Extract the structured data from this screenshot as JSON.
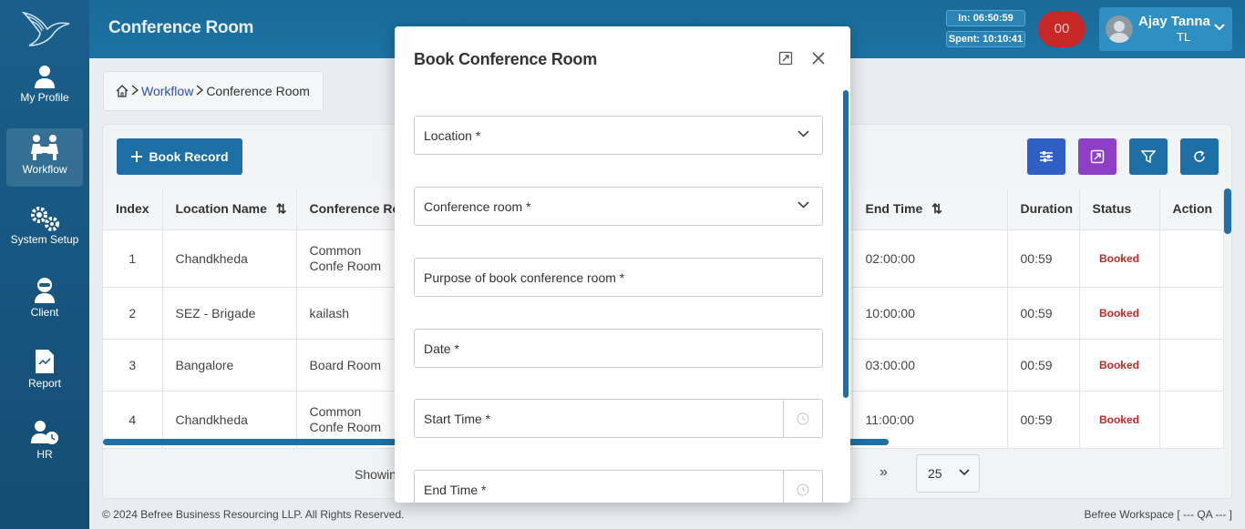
{
  "sidebar": {
    "items": [
      {
        "label": "My Profile",
        "icon": "user-icon"
      },
      {
        "label": "Workflow",
        "icon": "workflow-icon"
      },
      {
        "label": "System Setup",
        "icon": "gears-icon"
      },
      {
        "label": "Client",
        "icon": "client-icon"
      },
      {
        "label": "Report",
        "icon": "report-icon"
      },
      {
        "label": "HR",
        "icon": "hr-icon"
      }
    ]
  },
  "header": {
    "title": "Conference Room",
    "in_time": "In: 06:50:59",
    "spent_time": "Spent: 10:10:41",
    "count": "00",
    "user_name": "Ajay Tanna",
    "user_role": "TL"
  },
  "breadcrumb": {
    "workflow": "Workflow",
    "current": "Conference Room"
  },
  "toolbar": {
    "book_label": "Book Record"
  },
  "table": {
    "headers": [
      "Index",
      "Location Name",
      "Conference Roo",
      "End Time",
      "Duration",
      "Status",
      "Action"
    ],
    "rows": [
      {
        "index": "1",
        "location": "Chandkheda",
        "room": "Common Confe Room",
        "end": "02:00:00",
        "duration": "00:59",
        "status": "Booked"
      },
      {
        "index": "2",
        "location": "SEZ - Brigade",
        "room": "kailash",
        "end": "10:00:00",
        "duration": "00:59",
        "status": "Booked"
      },
      {
        "index": "3",
        "location": "Bangalore",
        "room": "Board Room",
        "end": "03:00:00",
        "duration": "00:59",
        "status": "Booked"
      },
      {
        "index": "4",
        "location": "Chandkheda",
        "room": "Common Confe Room",
        "end": "11:00:00",
        "duration": "00:59",
        "status": "Booked"
      }
    ]
  },
  "pager": {
    "showing": "Showin",
    "next": "»",
    "page_size": "25"
  },
  "footer": {
    "copyright": "© 2024 Befree Business Resourcing LLP. All Rights Reserved.",
    "workspace": "Befree Workspace [ --- QA --- ]"
  },
  "modal": {
    "title": "Book Conference Room",
    "fields": {
      "location": "Location *",
      "conference_room": "Conference room *",
      "purpose": "Purpose of book conference room *",
      "date": "Date *",
      "start_time": "Start Time *",
      "end_time": "End Time *"
    }
  },
  "colors": {
    "primary": "#1d6fa5",
    "sidebar": "#1a5f8c",
    "status_booked": "#c62828",
    "purple": "#8e3fc8",
    "indigo": "#2f5fc4"
  }
}
